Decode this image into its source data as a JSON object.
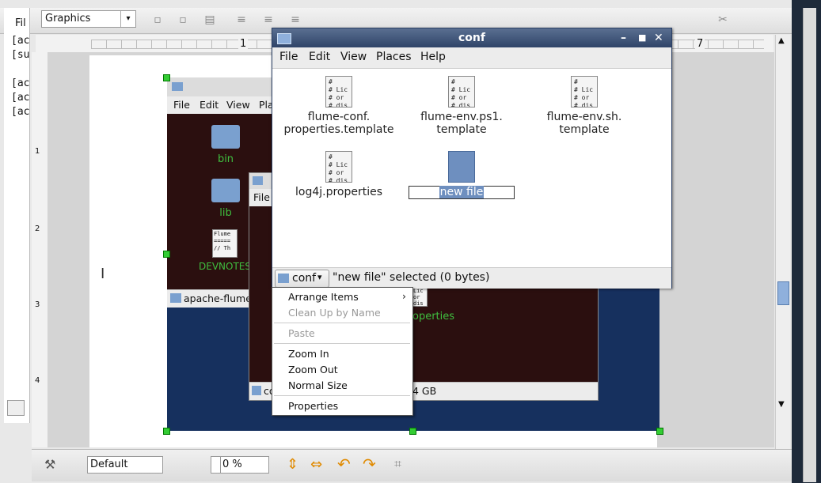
{
  "toolbar": {
    "style_combo": "Graphics",
    "left_panel_label": "Fil"
  },
  "left_panel": {
    "lines": [
      "[ac",
      "[su",
      "",
      "[ac",
      "[ac",
      "[ac"
    ]
  },
  "ruler": {
    "h_marks": [
      "1",
      "7"
    ],
    "v_marks": [
      "1",
      "2",
      "3",
      "4"
    ]
  },
  "background_window": {
    "menu": [
      "File",
      "Edit",
      "View",
      "Pla"
    ],
    "items": [
      "bin",
      "lib",
      "DEVNOTES"
    ],
    "doc_snippet": "Flume\n=====\n// Th",
    "status_folder": "apache-flume-",
    "inner_menu": "File",
    "inner_folder": "co",
    "inner_size": "4 GB",
    "inner_item": "operties",
    "inner_doc_snippet": "Lic\nor\ndis"
  },
  "conf_window": {
    "title": "conf",
    "menu": [
      "File",
      "Edit",
      "View",
      "Places",
      "Help"
    ],
    "files": [
      {
        "name_line1": "flume-conf.",
        "name_line2": "properties.template",
        "snippet": "#\n# Lic\n# or\n# dis\n# reg"
      },
      {
        "name_line1": "flume-env.ps1.",
        "name_line2": "template",
        "snippet": "#\n# Lic\n# or\n# dis\n# reg"
      },
      {
        "name_line1": "flume-env.sh.",
        "name_line2": "template",
        "snippet": "#\n# Lic\n# or\n# dis\n# reg"
      },
      {
        "name_line1": "log4j.properties",
        "name_line2": "",
        "snippet": "#\n# Lic\n# or\n# dis"
      }
    ],
    "new_file_name": "new file",
    "location": "conf",
    "status_text": "\"new file\" selected (0 bytes)"
  },
  "context_menu": {
    "arrange_items": "Arrange Items",
    "clean_up": "Clean Up by Name",
    "paste": "Paste",
    "zoom_in": "Zoom In",
    "zoom_out": "Zoom Out",
    "normal_size": "Normal Size",
    "properties": "Properties"
  },
  "bottom_toolbar": {
    "style": "Default",
    "percent": "0 %"
  },
  "colors": {
    "title_bar": "#2f4468",
    "selection": "#6e8fbf",
    "green_text": "#3fbf3f",
    "background_window": "#2b0f0f"
  }
}
